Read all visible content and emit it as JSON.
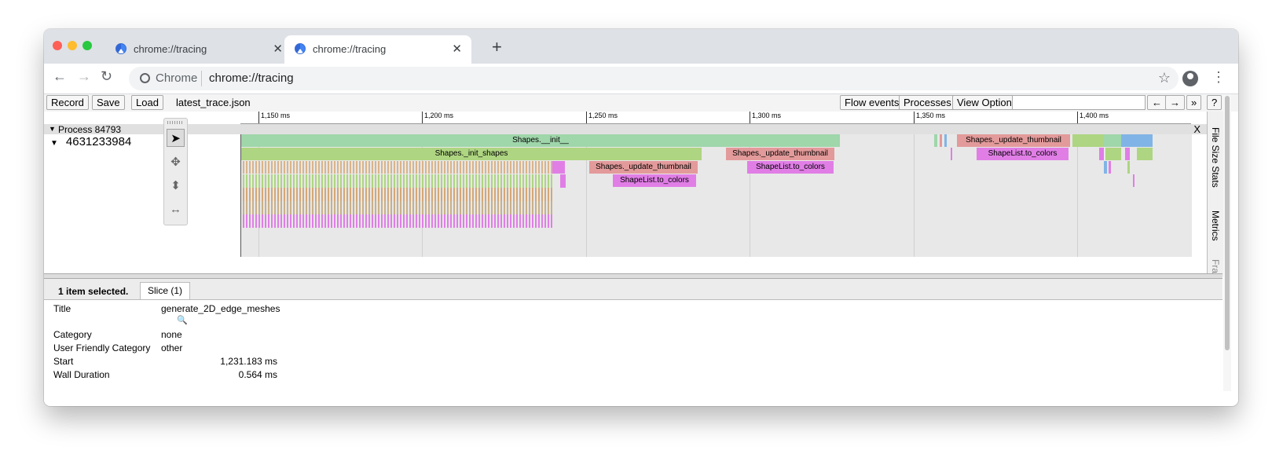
{
  "tabs": [
    {
      "title": "chrome://tracing",
      "close": "✕"
    },
    {
      "title": "chrome://tracing",
      "close": "✕"
    }
  ],
  "new_tab": "+",
  "toolbar": {
    "back": "←",
    "forward": "→",
    "reload": "↻",
    "site_label": "Chrome",
    "url": "chrome://tracing",
    "bookmark": "☆",
    "menu": "⋮"
  },
  "tracing": {
    "record": "Record",
    "save": "Save",
    "load": "Load",
    "filename": "latest_trace.json",
    "flow_events": "Flow events",
    "processes": "Processes",
    "view_options": "View Options",
    "search_placeholder": "",
    "prev": "←",
    "next": "→",
    "more": "»",
    "help": "?"
  },
  "ruler_ticks": [
    "1,150 ms",
    "1,200 ms",
    "1,250 ms",
    "1,300 ms",
    "1,350 ms",
    "1,400 ms"
  ],
  "process": {
    "label": "Process 84793",
    "close": "X"
  },
  "thread": {
    "label": "4631233984"
  },
  "slices": [
    {
      "name": "Shapes.__init__",
      "color": "#9fd6aa"
    },
    {
      "name": "Shapes._init_shapes",
      "color": "#aed581"
    },
    {
      "name": "Shapes._update_thumbnail",
      "color": "#e39a9a"
    },
    {
      "name": "ShapeList.to_colors",
      "color": "#e07ee6"
    },
    {
      "name": "Shapes._update_thumbnail",
      "color": "#e39a9a"
    },
    {
      "name": "ShapeList.to_colors",
      "color": "#e07ee6"
    },
    {
      "name": "Shapes._update_thumbnail",
      "color": "#e39a9a"
    },
    {
      "name": "ShapeList.to_colors",
      "color": "#e07ee6"
    }
  ],
  "side_tabs": [
    "File Size Stats",
    "Metrics",
    "Frame"
  ],
  "analysis": {
    "selection": "1 item selected.",
    "tab": "Slice (1)",
    "rows": [
      {
        "label": "Title",
        "value": "generate_2D_edge_meshes"
      },
      {
        "label": "Category",
        "value": "none"
      },
      {
        "label": "User Friendly Category",
        "value": "other"
      },
      {
        "label": "Start",
        "value": "1,231.183 ms"
      },
      {
        "label": "Wall Duration",
        "value": "0.564 ms"
      }
    ]
  }
}
